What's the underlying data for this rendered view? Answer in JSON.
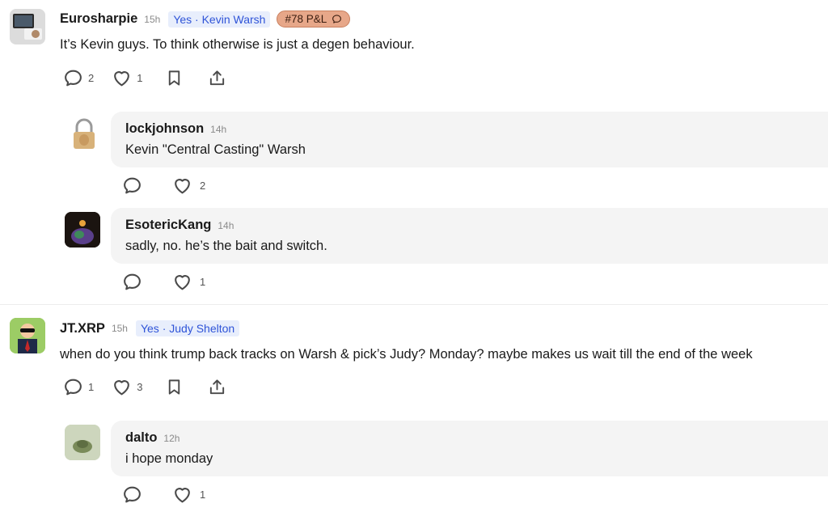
{
  "comments": [
    {
      "user": "Eurosharpie",
      "time": "15h",
      "position": "Yes · Kevin Warsh",
      "pnl": "#78 P&L",
      "text": "It’s Kevin guys. To think otherwise is just a degen behaviour.",
      "reply_count": "2",
      "like_count": "1",
      "replies": [
        {
          "user": "lockjohnson",
          "time": "14h",
          "text": "Kevin \"Central Casting\" Warsh",
          "like_count": "2"
        },
        {
          "user": "EsotericKang",
          "time": "14h",
          "text": "sadly, no. he’s the bait and switch.",
          "like_count": "1"
        }
      ]
    },
    {
      "user": "JT.XRP",
      "time": "15h",
      "position": "Yes · Judy Shelton",
      "text": "when do you think trump back tracks on Warsh & pick’s Judy? Monday? maybe makes us wait till the end of the week",
      "reply_count": "1",
      "like_count": "3",
      "replies": [
        {
          "user": "dalto",
          "time": "12h",
          "text": "i hope monday",
          "like_count": "1"
        }
      ]
    }
  ],
  "icons": {
    "reply": "comment-icon",
    "like": "heart-icon",
    "bookmark": "bookmark-icon",
    "share": "share-icon"
  },
  "colors": {
    "position_badge_bg": "#e8eefc",
    "position_badge_text": "#2f54d8",
    "pnl_badge_bg": "#e7a789"
  }
}
